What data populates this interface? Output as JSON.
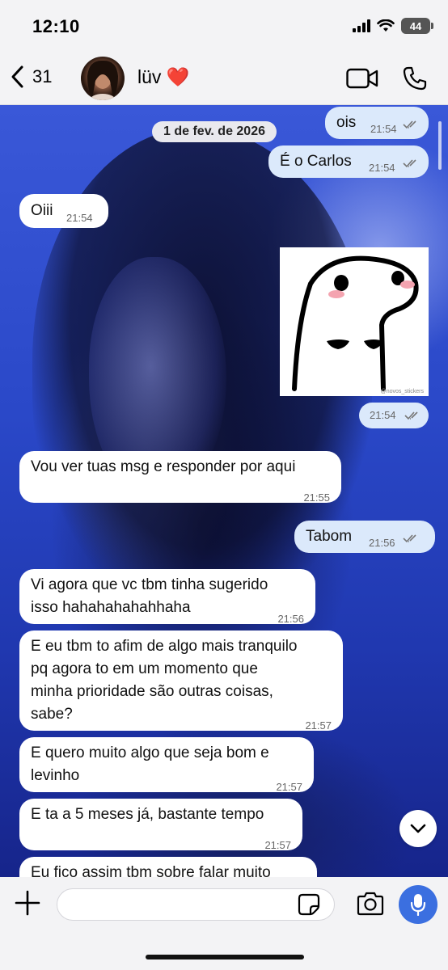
{
  "status_bar": {
    "time": "12:10",
    "battery": "44"
  },
  "header": {
    "back_count": "31",
    "contact_name": "lüv",
    "contact_emoji": "❤️",
    "icons": [
      "back-chevron-icon",
      "video-call-icon",
      "phone-icon"
    ]
  },
  "chat": {
    "date_label": "1 de fev. de 2026",
    "messages": [
      {
        "direction": "out",
        "text": "ois",
        "time": "21:54",
        "status": "read"
      },
      {
        "direction": "out",
        "text": "É o Carlos",
        "time": "21:54",
        "status": "read"
      },
      {
        "direction": "in",
        "text": "Oiii",
        "time": "21:54"
      },
      {
        "direction": "out",
        "type": "sticker",
        "sticker_caption": "@novos_stickers",
        "time": "21:54",
        "status": "read"
      },
      {
        "direction": "in",
        "text": "Vou ver tuas msg e responder por aqui",
        "time": "21:55"
      },
      {
        "direction": "out",
        "text": "Tabom",
        "time": "21:56",
        "status": "read"
      },
      {
        "direction": "in",
        "lines": [
          "Vi agora que vc tbm tinha sugerido",
          "isso hahahahahahhaha"
        ],
        "time": "21:56"
      },
      {
        "direction": "in",
        "lines": [
          "E eu tbm to afim de algo mais tranquilo",
          "pq agora to em um momento que",
          "minha prioridade são outras coisas,",
          "sabe?"
        ],
        "time": "21:57"
      },
      {
        "direction": "in",
        "lines": [
          "E quero muito algo que seja bom e",
          "levinho"
        ],
        "time": "21:57"
      },
      {
        "direction": "in",
        "text": "E ta a 5 meses já, bastante tempo",
        "time": "21:57"
      },
      {
        "direction": "in",
        "text": "Eu fico assim tbm sobre falar muito"
      }
    ]
  },
  "input_bar": {
    "placeholder": "",
    "icons": [
      "plus-icon",
      "sticker-icon",
      "camera-icon",
      "microphone-icon"
    ]
  },
  "colors": {
    "incoming_bubble": "#ffffff",
    "outgoing_bubble": "#dbe9fb",
    "mic_button": "#3b6fe0"
  }
}
